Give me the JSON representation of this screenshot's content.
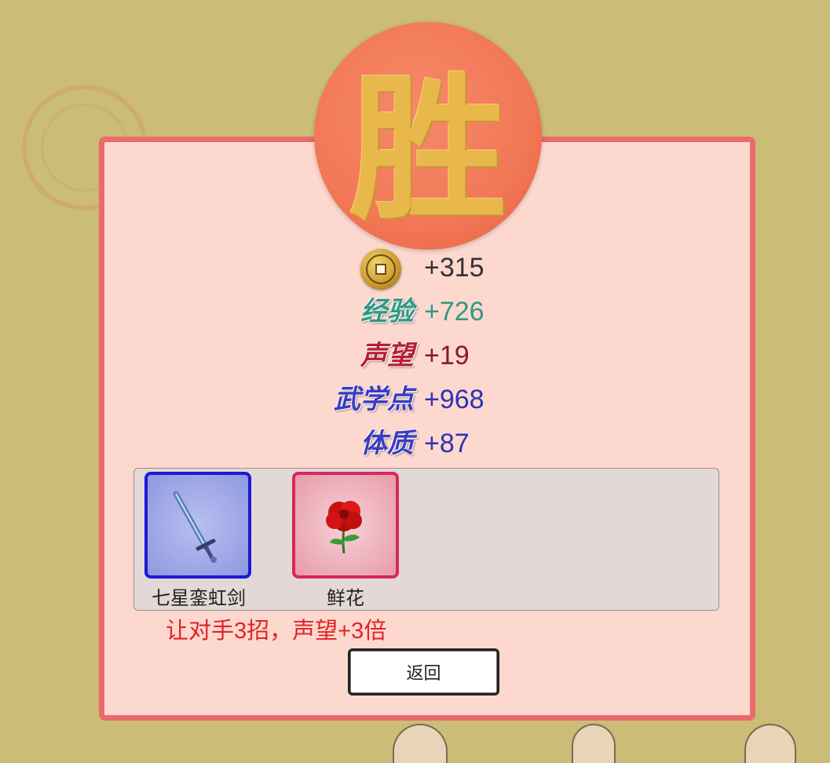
{
  "victory": {
    "glyph": "胜",
    "icon": "victory-seal"
  },
  "rewards": [
    {
      "key": "coins",
      "label": "",
      "value": "+315",
      "icon": "coin-icon",
      "color": "#333333"
    },
    {
      "key": "exp",
      "label": "经验",
      "value": "+726",
      "color": "#2f9a84"
    },
    {
      "key": "reputation",
      "label": "声望",
      "value": "+19",
      "color": "#8a1a2a"
    },
    {
      "key": "martial_points",
      "label": "武学点",
      "value": "+968",
      "color": "#3032b8"
    },
    {
      "key": "constitution",
      "label": "体质",
      "value": "+87",
      "color": "#3032b8"
    }
  ],
  "items": [
    {
      "name": "七星銮虹剑",
      "icon": "sword-icon",
      "border_color": "#1a1ad8"
    },
    {
      "name": "鲜花",
      "icon": "flower-icon",
      "border_color": "#d8285a"
    }
  ],
  "bonus_note": "让对手3招，声望+3倍",
  "return_button": "返回",
  "colors": {
    "background": "#cbbc78",
    "panel": "#fdd8cf",
    "panel_border": "#ea6b6b",
    "seal": "#f27856",
    "glyph": "#e9b84a",
    "note": "#e02424"
  }
}
